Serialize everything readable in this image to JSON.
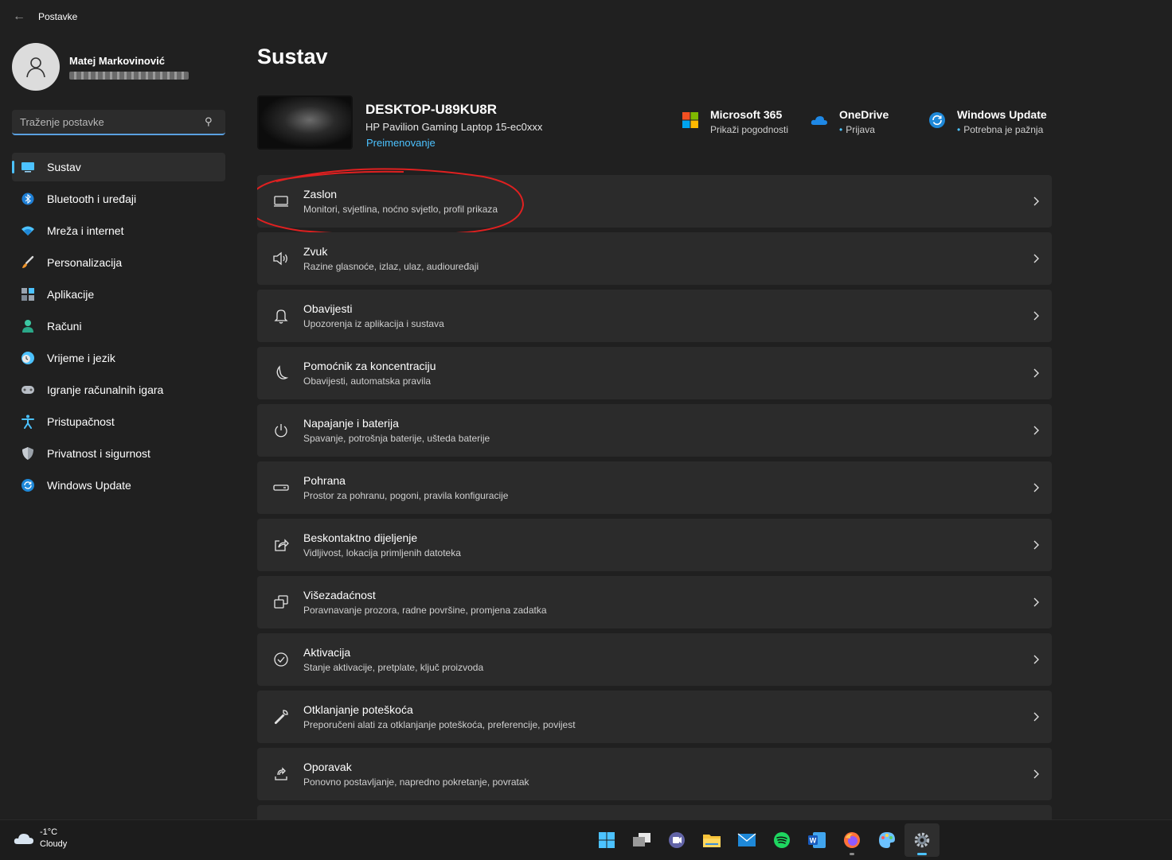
{
  "window": {
    "title": "Postavke"
  },
  "profile": {
    "name": "Matej Markovinović"
  },
  "search": {
    "placeholder": "Traženje postavke"
  },
  "sidebar": {
    "items": [
      {
        "label": "Sustav",
        "icon": "monitor-icon",
        "selected": true
      },
      {
        "label": "Bluetooth i uređaji",
        "icon": "bluetooth-icon"
      },
      {
        "label": "Mreža i internet",
        "icon": "wifi-icon"
      },
      {
        "label": "Personalizacija",
        "icon": "brush-icon"
      },
      {
        "label": "Aplikacije",
        "icon": "apps-icon"
      },
      {
        "label": "Računi",
        "icon": "person-icon"
      },
      {
        "label": "Vrijeme i jezik",
        "icon": "clock-globe-icon"
      },
      {
        "label": "Igranje računalnih igara",
        "icon": "gamepad-icon"
      },
      {
        "label": "Pristupačnost",
        "icon": "accessibility-icon"
      },
      {
        "label": "Privatnost i sigurnost",
        "icon": "shield-icon"
      },
      {
        "label": "Windows Update",
        "icon": "update-icon"
      }
    ]
  },
  "main": {
    "title": "Sustav",
    "device": {
      "name": "DESKTOP-U89KU8R",
      "model": "HP Pavilion Gaming Laptop 15-ec0xxx",
      "rename": "Preimenovanje"
    },
    "quick": [
      {
        "title": "Microsoft 365",
        "subtitle": "Prikaži pogodnosti",
        "icon": "microsoft-logo-icon",
        "dot": false
      },
      {
        "title": "OneDrive",
        "subtitle": "Prijava",
        "icon": "onedrive-cloud-icon",
        "dot": true
      },
      {
        "title": "Windows Update",
        "subtitle": "Potrebna je pažnja",
        "icon": "update-icon",
        "dot": true
      }
    ],
    "cards": [
      {
        "title": "Zaslon",
        "subtitle": "Monitori, svjetlina, noćno svjetlo, profil prikaza",
        "icon": "display-icon"
      },
      {
        "title": "Zvuk",
        "subtitle": "Razine glasnoće, izlaz, ulaz, audiouređaji",
        "icon": "speaker-icon"
      },
      {
        "title": "Obavijesti",
        "subtitle": "Upozorenja iz aplikacija i sustava",
        "icon": "bell-icon"
      },
      {
        "title": "Pomoćnik za koncentraciju",
        "subtitle": "Obavijesti, automatska pravila",
        "icon": "moon-icon"
      },
      {
        "title": "Napajanje i baterija",
        "subtitle": "Spavanje, potrošnja baterije, ušteda baterije",
        "icon": "power-icon"
      },
      {
        "title": "Pohrana",
        "subtitle": "Prostor za pohranu, pogoni, pravila konfiguracije",
        "icon": "storage-drive-icon"
      },
      {
        "title": "Beskontaktno dijeljenje",
        "subtitle": "Vidljivost, lokacija primljenih datoteka",
        "icon": "share-icon"
      },
      {
        "title": "Višezadaćnost",
        "subtitle": "Poravnavanje prozora, radne površine, promjena zadatka",
        "icon": "multitasking-icon"
      },
      {
        "title": "Aktivacija",
        "subtitle": "Stanje aktivacije, pretplate, ključ proizvoda",
        "icon": "check-circle-icon"
      },
      {
        "title": "Otklanjanje poteškoća",
        "subtitle": "Preporučeni alati za otklanjanje poteškoća, preferencije, povijest",
        "icon": "wrench-icon"
      },
      {
        "title": "Oporavak",
        "subtitle": "Ponovno postavljanje, napredno pokretanje, povratak",
        "icon": "recovery-icon"
      }
    ]
  },
  "taskbar": {
    "weather": {
      "temp": "-1°C",
      "condition": "Cloudy"
    },
    "apps": [
      "start-icon",
      "task-view-icon",
      "teams-chat-icon",
      "file-explorer-icon",
      "mail-icon",
      "spotify-icon",
      "word-icon",
      "firefox-icon",
      "paint-icon",
      "settings-icon"
    ]
  },
  "colors": {
    "accent": "#4cc2ff",
    "background": "#202020",
    "card": "#2b2b2b",
    "highlight_annotation": "#e02020"
  }
}
